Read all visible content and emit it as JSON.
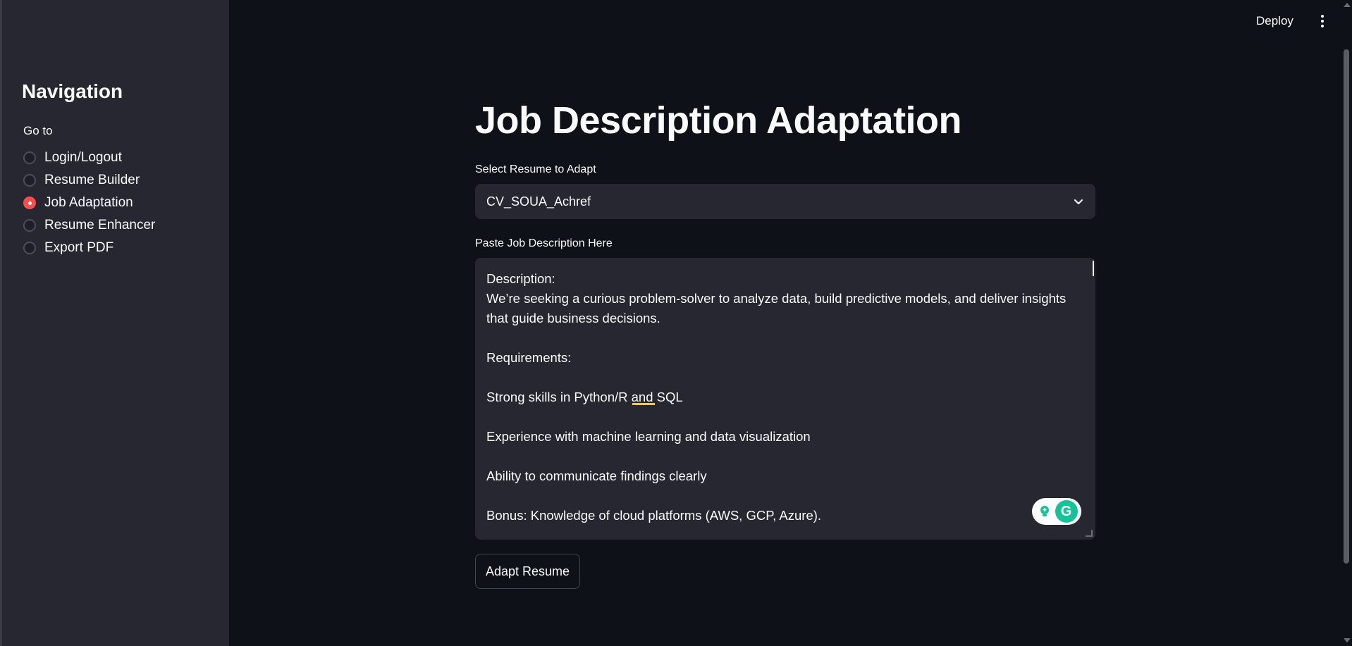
{
  "topbar": {
    "deploy_label": "Deploy",
    "menu_icon": "kebab-icon"
  },
  "sidebar": {
    "title": "Navigation",
    "group_label": "Go to",
    "items": [
      {
        "label": "Login/Logout",
        "selected": false
      },
      {
        "label": "Resume Builder",
        "selected": false
      },
      {
        "label": "Job Adaptation",
        "selected": true
      },
      {
        "label": "Resume Enhancer",
        "selected": false
      },
      {
        "label": "Export PDF",
        "selected": false
      }
    ]
  },
  "main": {
    "title": "Job Description Adaptation",
    "select_label": "Select Resume to Adapt",
    "select_value": "CV_SOUA_Achref",
    "textarea_label": "Paste Job Description Here",
    "textarea_value": "Description:\nWe’re seeking a curious problem-solver to analyze data, build predictive models, and deliver insights\nthat guide business decisions.\n\nRequirements:\n\nStrong skills in Python/R and SQL\n\nExperience with machine learning and data visualization\n\nAbility to communicate findings clearly\n\nBonus: Knowledge of cloud platforms (AWS, GCP, Azure).",
    "button_label": "Adapt Resume"
  },
  "colors": {
    "accent": "#ff4b4b",
    "background": "#0e1117",
    "sidebar": "#262730",
    "grammarly": "#15c39a"
  }
}
